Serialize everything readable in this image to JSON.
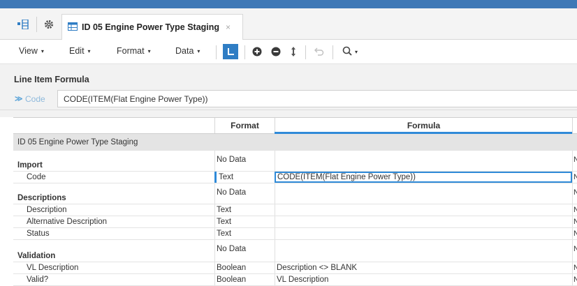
{
  "tab": {
    "title": "ID 05 Engine Power Type Staging",
    "close": "×"
  },
  "toolbar": {
    "menus": [
      "View",
      "Edit",
      "Format",
      "Data"
    ],
    "caret": "▾",
    "search_caret": "▾"
  },
  "formula_panel": {
    "title": "Line Item Formula",
    "field_label": "Code",
    "chevron": "≫",
    "formula": "CODE(ITEM(Flat Engine Power Type))"
  },
  "grid": {
    "columns": [
      "Format",
      "Formula"
    ],
    "module_title": "ID 05 Engine Power Type Staging",
    "extra_col_text": "N",
    "rows": [
      {
        "name": "Import",
        "kind": "section",
        "format": "No Data",
        "formula": ""
      },
      {
        "name": "Code",
        "kind": "child",
        "format": "Text",
        "formula": "CODE(ITEM(Flat Engine Power Type))",
        "selected": true
      },
      {
        "name": "Descriptions",
        "kind": "section",
        "format": "No Data",
        "formula": ""
      },
      {
        "name": "Description",
        "kind": "child",
        "format": "Text",
        "formula": ""
      },
      {
        "name": "Alternative Description",
        "kind": "child",
        "format": "Text",
        "formula": ""
      },
      {
        "name": "Status",
        "kind": "child",
        "format": "Text",
        "formula": ""
      },
      {
        "name": "Validation",
        "kind": "section",
        "format": "No Data",
        "formula": ""
      },
      {
        "name": "VL Description",
        "kind": "child",
        "format": "Boolean",
        "formula": "Description <> BLANK"
      },
      {
        "name": "Valid?",
        "kind": "child",
        "format": "Boolean",
        "formula": "VL Description"
      }
    ]
  },
  "colors": {
    "accent": "#2f7dc4",
    "header_bar": "#3f79b6",
    "selection": "#2f8ad8"
  },
  "icons": [
    "grid-layout-icon",
    "gear-icon",
    "module-icon",
    "pointer-icon",
    "add-circle-icon",
    "remove-circle-icon",
    "sort-icon",
    "undo-icon",
    "search-icon"
  ]
}
